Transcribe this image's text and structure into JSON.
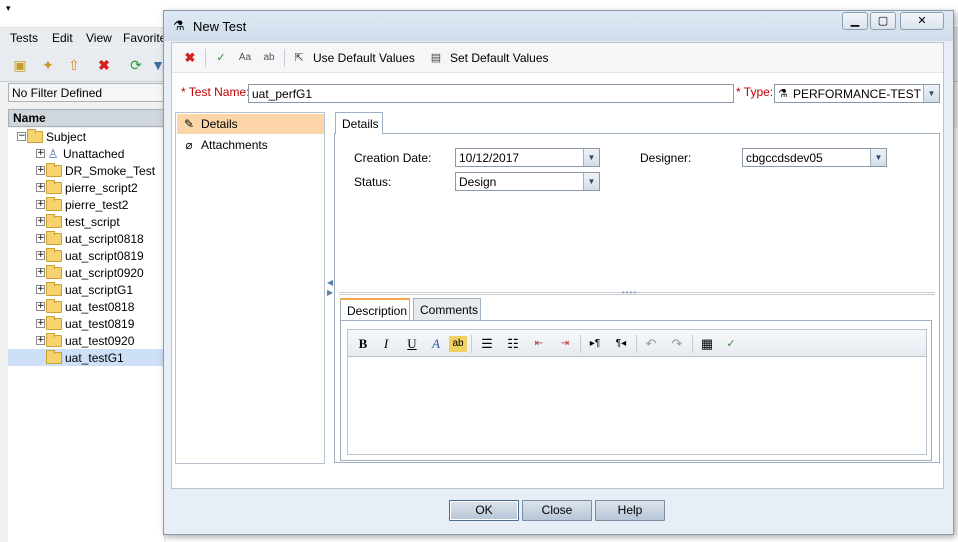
{
  "app": {
    "menu": [
      "Tests",
      "Edit",
      "View",
      "Favorite"
    ],
    "filter_text": "No Filter Defined",
    "tree_header": "Name",
    "tree": [
      {
        "label": "Subject",
        "kind": "root"
      },
      {
        "label": "Unattached",
        "kind": "user"
      },
      {
        "label": "DR_Smoke_Test",
        "kind": "folder"
      },
      {
        "label": "pierre_script2",
        "kind": "folder"
      },
      {
        "label": "pierre_test2",
        "kind": "folder"
      },
      {
        "label": "test_script",
        "kind": "folder"
      },
      {
        "label": "uat_script0818",
        "kind": "folder"
      },
      {
        "label": "uat_script0819",
        "kind": "folder"
      },
      {
        "label": "uat_script0920",
        "kind": "folder"
      },
      {
        "label": "uat_scriptG1",
        "kind": "folder"
      },
      {
        "label": "uat_test0818",
        "kind": "folder"
      },
      {
        "label": "uat_test0819",
        "kind": "folder"
      },
      {
        "label": "uat_test0920",
        "kind": "folder"
      },
      {
        "label": "uat_testG1",
        "kind": "folder",
        "selected": true
      }
    ]
  },
  "dialog": {
    "title": "New Test",
    "toolbar": {
      "use_defaults": "Use Default Values",
      "set_defaults": "Set Default Values"
    },
    "test_name_label": "* Test Name:",
    "test_name_value": "uat_perfG1",
    "type_label": "* Type:",
    "type_value": "PERFORMANCE-TEST",
    "nav": [
      "Details",
      "Attachments"
    ],
    "details_tab": "Details",
    "fields": {
      "creation_date_label": "Creation Date:",
      "creation_date_value": "10/12/2017",
      "designer_label": "Designer:",
      "designer_value": "cbgccdsdev05",
      "status_label": "Status:",
      "status_value": "Design"
    },
    "sub_tabs": [
      "Description",
      "Comments"
    ],
    "buttons": {
      "ok": "OK",
      "close": "Close",
      "help": "Help"
    }
  }
}
